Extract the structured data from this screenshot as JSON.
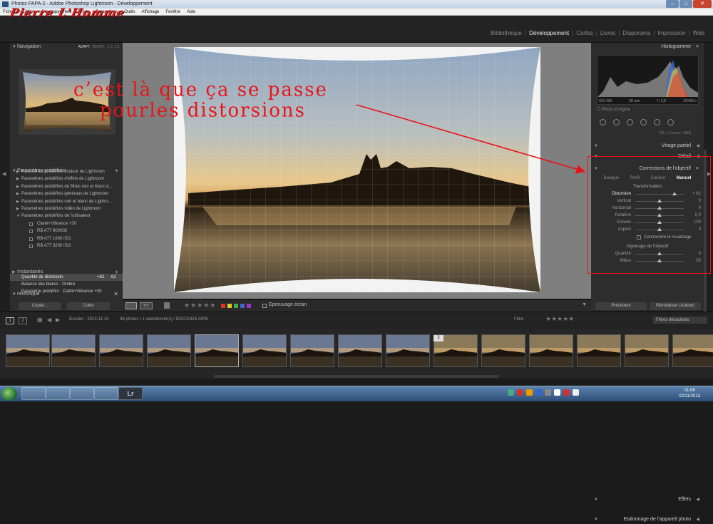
{
  "window": {
    "title": "Photos PAPA-2 - Adobe Photoshop Lightroom - Développement"
  },
  "menu": [
    "Fichier",
    "Edition",
    "Développement",
    "Photo",
    "Paramètres",
    "Outils",
    "Affichage",
    "Fenêtre",
    "Aide"
  ],
  "logo_text": "Pierre L'Homme",
  "modules": [
    "Bibliothèque",
    "Développement",
    "Cartes",
    "Livres",
    "Diaporama",
    "Impression",
    "Web"
  ],
  "active_module": "Développement",
  "navigator": {
    "title": "Navigation",
    "opt1": "ADAPT.",
    "opt2": "REMPL.",
    "opt3": "1:1",
    "opt4": "2:1"
  },
  "presets": {
    "title": "Paramètres prédéfinis",
    "items": [
      "Paramètres prédéfinis couleur de Lightroom",
      "Paramètres prédéfinis d'effets de Lightroom",
      "Paramètres prédéfinis de filtres noir et blanc d...",
      "Paramètres prédéfinis généraux de Lightroom",
      "Paramètres prédéfinis noir et blanc de Lightro...",
      "Paramètres prédéfinis vidéo de Lightroom",
      "Paramètres prédéfinis de l'utilisateur"
    ],
    "user_items": [
      "Clarté+Vibrance +30",
      "RB A77 800ISO",
      "RB A77 1600 ISO",
      "RB A77 3200 ISO"
    ]
  },
  "snapshots": {
    "title": "Instantanés"
  },
  "history": {
    "title": "Historique",
    "items": [
      {
        "label": "Quantité de distorsion",
        "v1": "+62",
        "v2": "62"
      },
      {
        "label": "Balance des blancs : Ombre",
        "v1": "",
        "v2": ""
      },
      {
        "label": "Paramètre prédéfini : Clarté+Vibrance +30",
        "v1": "",
        "v2": ""
      }
    ]
  },
  "left_buttons": {
    "copy": "Copier...",
    "paste": "Coller"
  },
  "histogram": {
    "title": "Histogramme",
    "iso": "ISO 400",
    "focal": "28 mm",
    "aperture": "f / 2,8",
    "shutter": "1/6400 s",
    "original": "Photo d'origine"
  },
  "right_sections": {
    "hsl": "TSL / Couleur / N&B",
    "split": "Virage partiel",
    "detail": "Détail",
    "lens": "Corrections de l'objectif",
    "effects": "Effets",
    "calib": "Etalonnage de l'appareil photo"
  },
  "lens_tabs": [
    "Basique",
    "Profil",
    "Couleur",
    "Manuel"
  ],
  "lens_active_tab": "Manuel",
  "transform": {
    "title": "Transformation",
    "sliders": [
      {
        "label": "Distorsion",
        "value": "+ 62",
        "level": 0.81
      },
      {
        "label": "Vertical",
        "value": "0",
        "level": 0.5
      },
      {
        "label": "Horizontal",
        "value": "0",
        "level": 0.5
      },
      {
        "label": "Rotation",
        "value": "0,0",
        "level": 0.5
      },
      {
        "label": "Echelle",
        "value": "100",
        "level": 0.5
      },
      {
        "label": "Aspect",
        "value": "0",
        "level": 0.5
      }
    ],
    "constrain": "Contraindre le recadrage"
  },
  "vignette": {
    "title": "Vignetage de l'objectif",
    "sliders": [
      {
        "label": "Quantité",
        "value": "0",
        "level": 0.5
      },
      {
        "label": "Milieu",
        "value": "50",
        "level": 0.5
      }
    ]
  },
  "right_buttons": {
    "previous": "Précédent",
    "reset": "Réinitialiser (Adobe)"
  },
  "toolbar": {
    "softproof": "Epreuvage écran"
  },
  "filmbar": {
    "page1": "1",
    "page2": "2",
    "folder": "Dossier : 2013-11-10",
    "count": "36 photos / 1 sélectionné(s) / DSC02493.ARW",
    "filter_label": "Filtre :",
    "filter_value": "Filtres désactivés"
  },
  "thumb_badge": "2",
  "clock": {
    "time": "01:06",
    "date": "02/11/2013"
  },
  "annotation": {
    "line1": "c’est là que ça se passe",
    "line2": "pourles distorsions"
  },
  "colors": {
    "annotation": "#e8141a",
    "bg": "#1b1b1b",
    "panel": "#2d2d2d"
  }
}
